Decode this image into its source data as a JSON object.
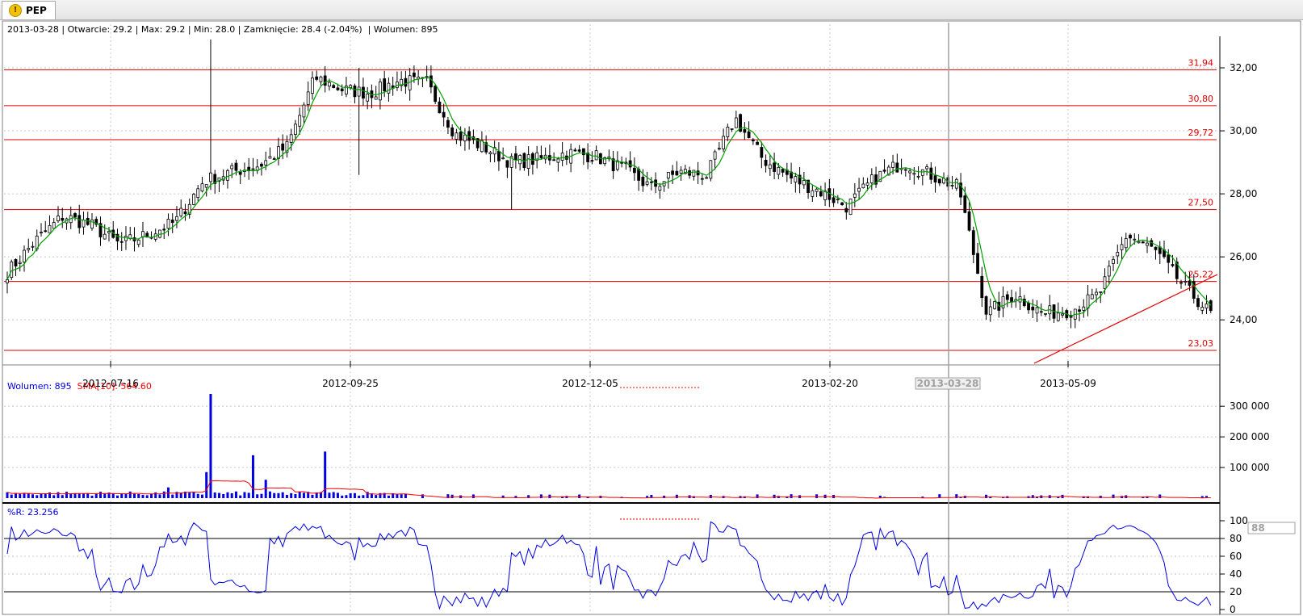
{
  "tab": {
    "label": "PEP",
    "icon": "warning-icon"
  },
  "ohlc_info": "2013-03-28 | Otwarcie: 29.2 | Max: 29.2 | Min: 28.0 | Zamknięcie: 28.4 (-2.04%)  | Wolumen: 895",
  "volume_info": {
    "label": "Wolumen: 895",
    "sma": "SMA[10]: 564.60"
  },
  "wr_info": "%R: 23.256",
  "crosshair_date": "2013-03-28",
  "crosshair_value": "88",
  "colors": {
    "up": "#ffffff",
    "down": "#000000",
    "sma_price": "#00a000",
    "volume": "#0000e0",
    "volume_sma": "#ff0000",
    "levels": "#e00000",
    "wr": "#0000e0"
  },
  "chart_data": [
    {
      "type": "candlestick",
      "x_ticks": [
        "2012-07-16",
        "2012-09-25",
        "2012-12-05",
        "2013-02-20",
        "2013-05-09"
      ],
      "y_ticks": [
        "24,00",
        "26,00",
        "28,00",
        "30,00",
        "32,00"
      ],
      "ylim": [
        22.8,
        33.0
      ],
      "levels": [
        {
          "value": 31.94,
          "label": "31,94"
        },
        {
          "value": 30.8,
          "label": "30,80"
        },
        {
          "value": 29.72,
          "label": "29,72"
        },
        {
          "value": 27.5,
          "label": "27,50"
        },
        {
          "value": 25.22,
          "label": "25,22"
        },
        {
          "value": 23.03,
          "label": "23,03"
        }
      ],
      "anchors": [
        [
          25.5,
          25.6
        ],
        [
          26.5,
          26.8
        ],
        [
          27.3,
          27.2
        ],
        [
          27.0,
          26.9
        ],
        [
          26.4,
          26.2
        ],
        [
          26.7,
          26.9
        ],
        [
          27.1,
          27.3
        ],
        [
          28.4,
          28.6
        ],
        [
          28.7,
          28.8
        ],
        [
          28.9,
          28.8
        ],
        [
          29.5,
          31.2
        ],
        [
          31.7,
          31.6
        ],
        [
          31.3,
          31.1
        ],
        [
          31.2,
          31.5
        ],
        [
          31.6,
          31.3
        ],
        [
          31.5,
          31.8
        ],
        [
          29.9,
          29.6
        ],
        [
          29.5,
          29.2
        ],
        [
          29.0,
          28.8
        ],
        [
          29.1,
          29.0
        ],
        [
          29.3,
          29.1
        ],
        [
          29.2,
          29.4
        ],
        [
          28.8,
          28.4
        ],
        [
          28.2,
          28.5
        ],
        [
          28.7,
          28.9
        ],
        [
          28.6,
          28.3
        ],
        [
          30.4,
          30.3
        ],
        [
          29.1,
          28.7
        ],
        [
          28.5,
          28.3
        ],
        [
          28.1,
          27.9
        ],
        [
          27.6,
          27.9
        ],
        [
          28.5,
          29.3
        ],
        [
          29.0,
          29.2
        ],
        [
          28.6,
          28.4
        ],
        [
          28.2,
          28.0
        ],
        [
          24.2,
          24.4
        ],
        [
          24.8,
          24.9
        ],
        [
          24.2,
          24.0
        ],
        [
          24.3,
          24.5
        ],
        [
          24.8,
          25.3
        ],
        [
          26.7,
          26.9
        ],
        [
          26.2,
          25.8
        ],
        [
          25.1,
          23.8
        ],
        [
          24.2,
          24.6
        ]
      ],
      "volume_ticks": [
        "100 000",
        "200 000",
        "300 000"
      ],
      "volume_ylim": [
        0,
        340000
      ],
      "volume_peaks": [
        {
          "index": 48,
          "value": 340000
        },
        {
          "index": 47,
          "value": 85000
        },
        {
          "index": 58,
          "value": 140000
        },
        {
          "index": 75,
          "value": 152000
        },
        {
          "index": 61,
          "value": 60000
        },
        {
          "index": 38,
          "value": 35000
        }
      ],
      "wr_ticks": [
        "0",
        "20",
        "40",
        "60",
        "80",
        "100"
      ],
      "wr_ylim": [
        0,
        100
      ],
      "wr_levels": [
        20,
        80
      ]
    }
  ]
}
